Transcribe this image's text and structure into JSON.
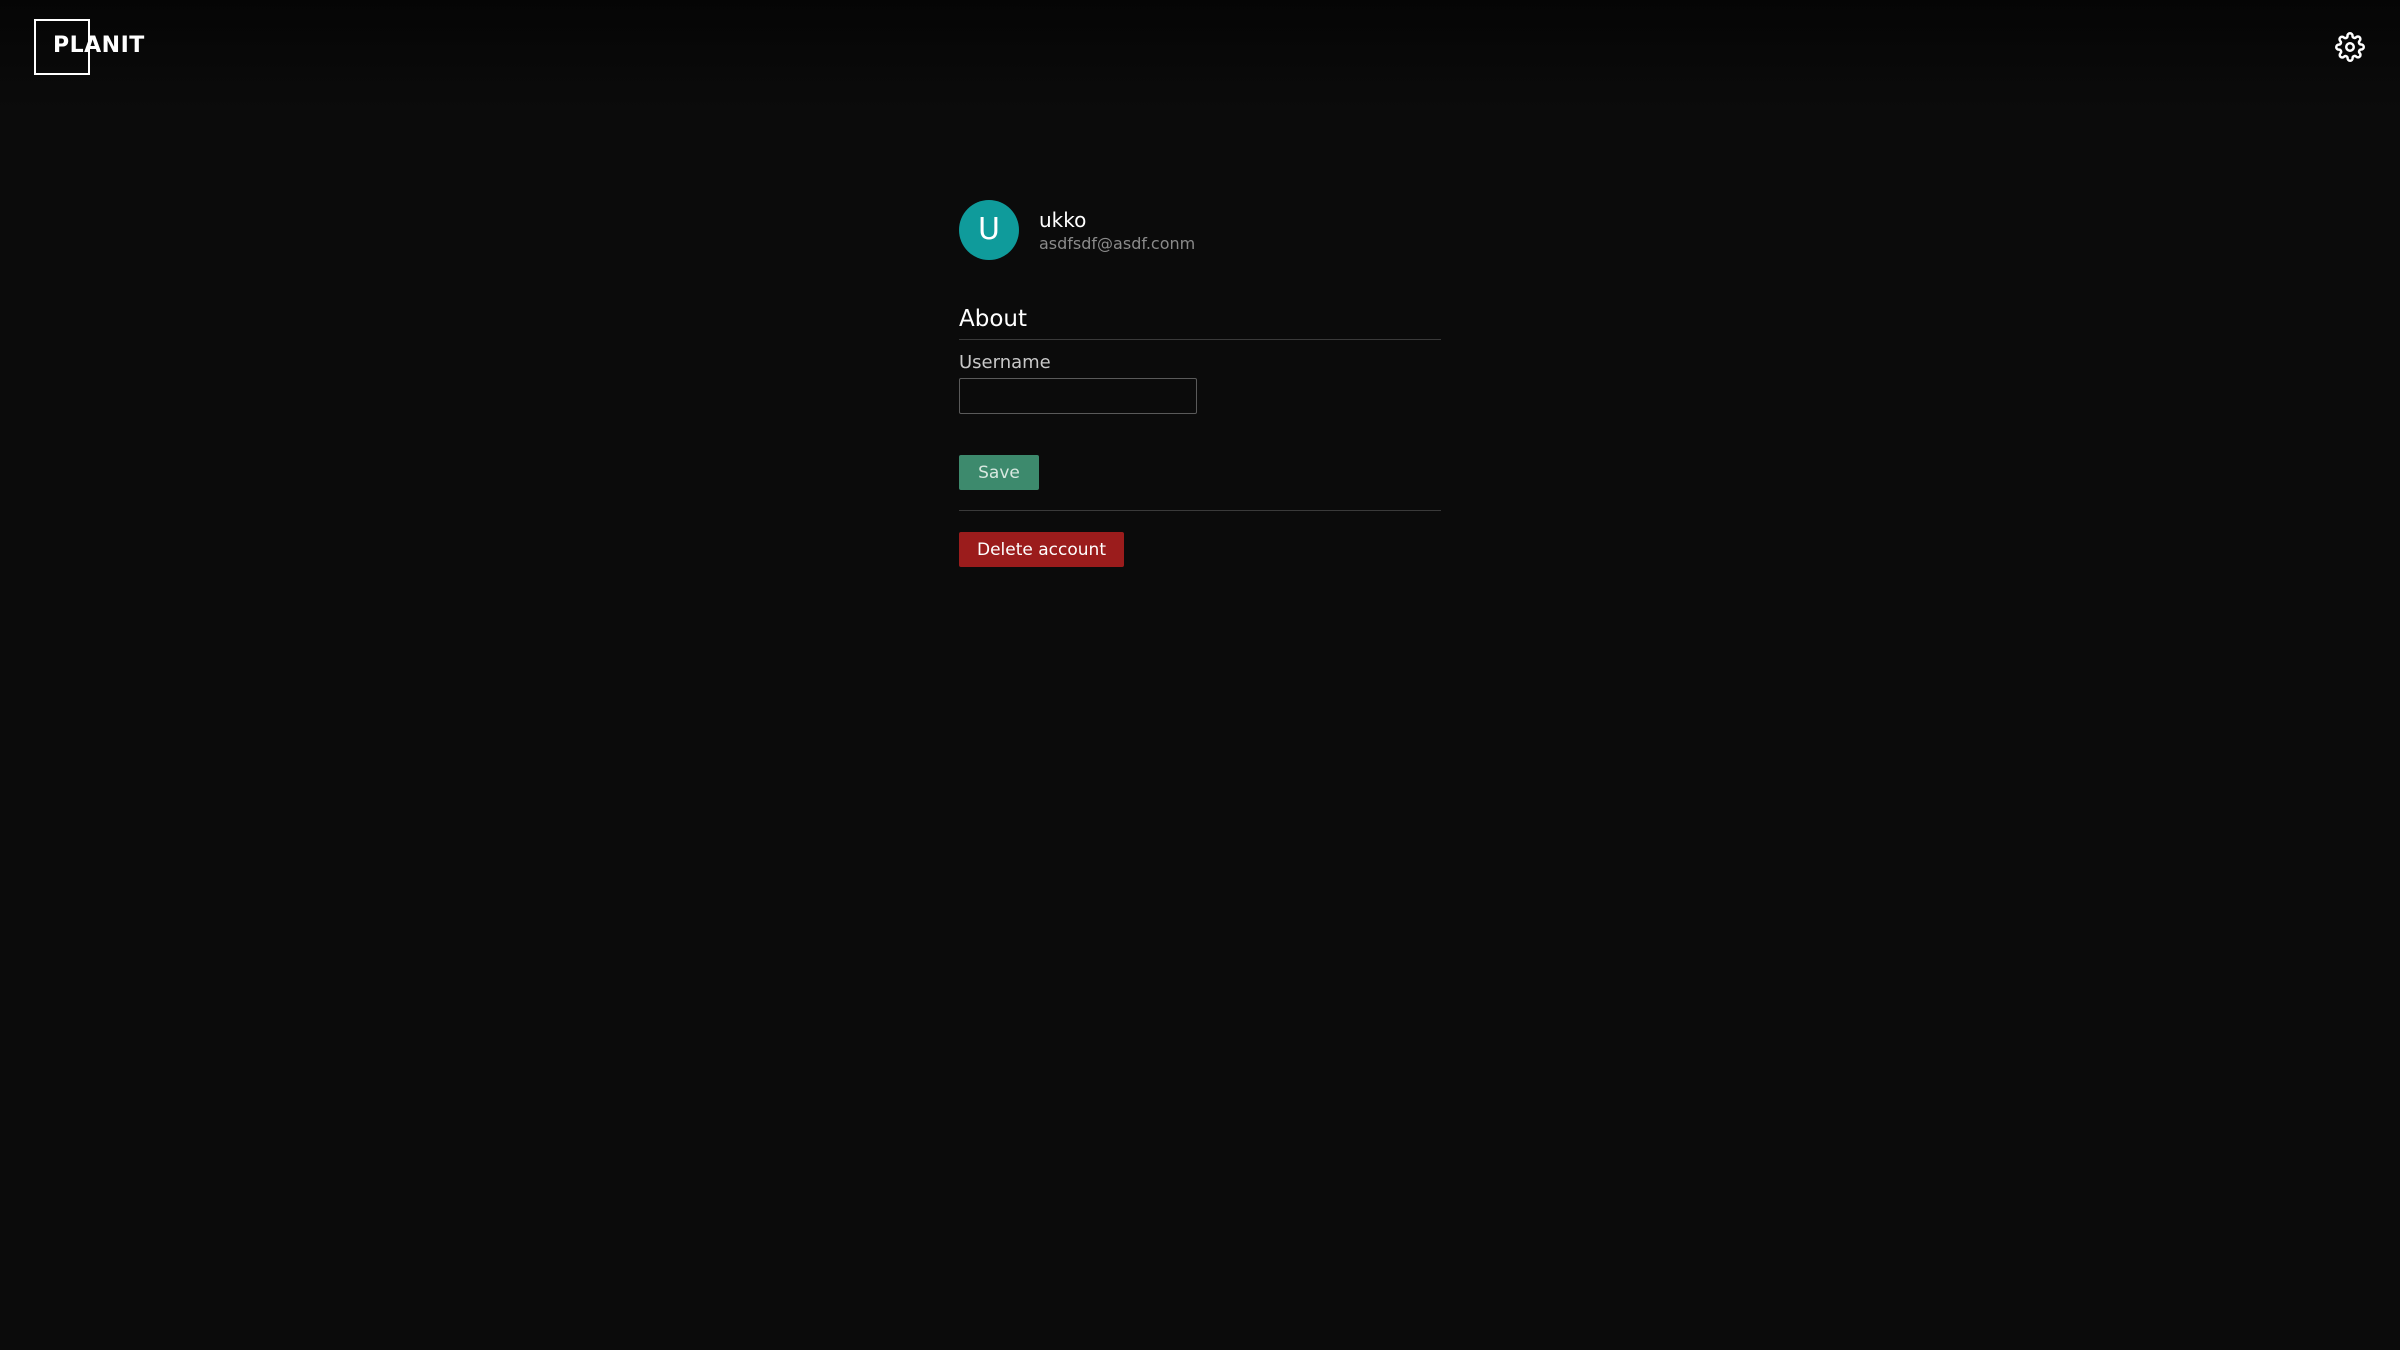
{
  "header": {
    "logo_text": "PLANIT",
    "settings_icon": "gear-icon"
  },
  "profile": {
    "avatar_initial": "U",
    "avatar_color": "#0f9b9b",
    "username": "ukko",
    "email": "asdfsdf@asdf.conm"
  },
  "about": {
    "title": "About",
    "username_label": "Username",
    "username_value": "",
    "save_label": "Save",
    "delete_label": "Delete account"
  },
  "colors": {
    "background": "#0b0b0b",
    "save": "#3d8a6d",
    "delete": "#9b1c1c"
  }
}
